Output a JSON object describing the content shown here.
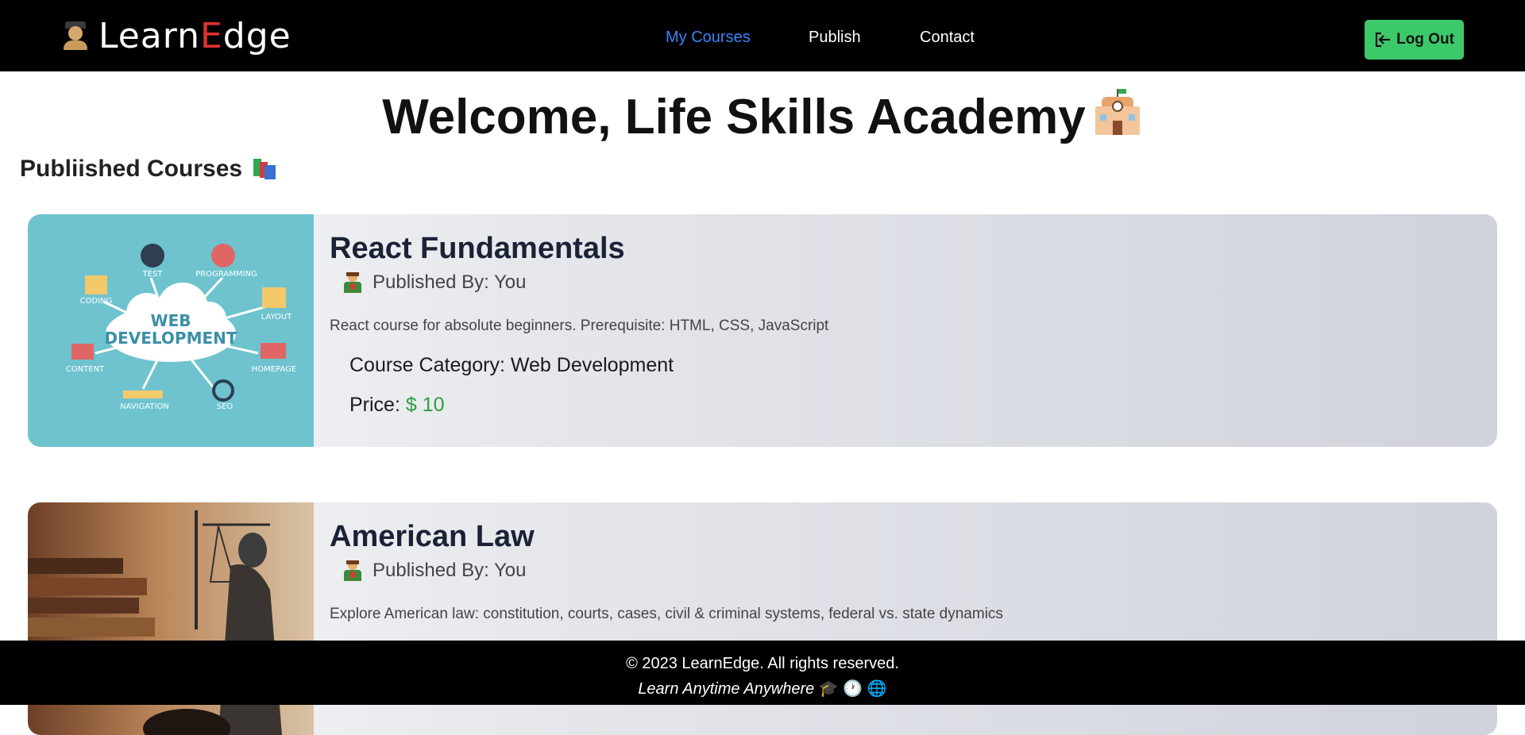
{
  "brand": {
    "name_part1": "Learn",
    "name_accent": "E",
    "name_part2": "dge",
    "logo_icon": "student-icon"
  },
  "nav": {
    "items": [
      {
        "label": "My Courses",
        "active": true
      },
      {
        "label": "Publish",
        "active": false
      },
      {
        "label": "Contact",
        "active": false
      }
    ],
    "logout_label": "Log Out",
    "logout_icon": "logout-icon",
    "logout_color": "#3cc96a",
    "active_color": "#3b82f6"
  },
  "welcome": {
    "text": "Welcome, Life Skills Academy",
    "icon": "school-icon"
  },
  "section": {
    "title": "Publiished Courses",
    "icon": "books-icon"
  },
  "courses": [
    {
      "title": "React Fundamentals",
      "publisher": "Published By: You",
      "description": "React course for absolute beginners. Prerequisite: HTML, CSS, JavaScript",
      "category_label": "Course Category: Web Development",
      "price_label": "Price:",
      "price_value": "$ 10",
      "image": {
        "title_line1": "WEB",
        "title_line2": "DEVELOPMENT",
        "labels": [
          "TEST",
          "PROGRAMMING",
          "CODING",
          "LAYOUT",
          "CONTENT",
          "HOMEPAGE",
          "NAVIGATION",
          "SEO"
        ]
      }
    },
    {
      "title": "American Law",
      "publisher": "Published By: You",
      "description": "Explore American law: constitution, courts, cases, civil & criminal systems, federal vs. state dynamics",
      "image": {
        "subject": "lady-justice-statue"
      }
    }
  ],
  "footer": {
    "copyright": "© 2023 LearnEdge. All rights reserved.",
    "tagline": "Learn Anytime Anywhere",
    "tagline_icons": "🎓 🕐 🌐"
  }
}
